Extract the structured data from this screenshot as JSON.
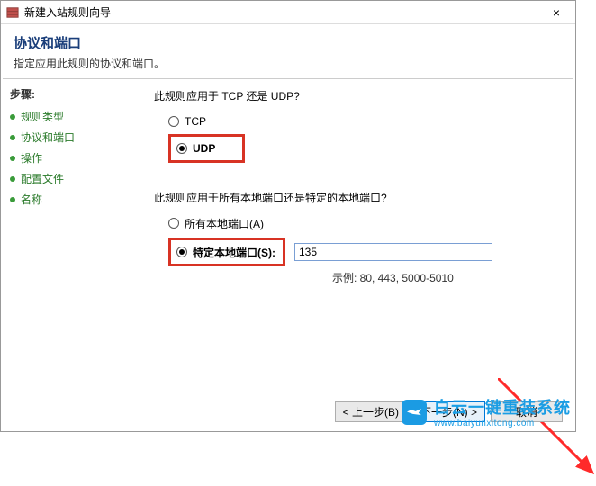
{
  "titlebar": {
    "title": "新建入站规则向导",
    "close": "×"
  },
  "header": {
    "title": "协议和端口",
    "subtitle": "指定应用此规则的协议和端口。"
  },
  "sidebar": {
    "heading": "步骤:",
    "items": [
      {
        "label": "规则类型"
      },
      {
        "label": "协议和端口"
      },
      {
        "label": "操作"
      },
      {
        "label": "配置文件"
      },
      {
        "label": "名称"
      }
    ]
  },
  "content": {
    "question1": "此规则应用于 TCP 还是 UDP?",
    "opt_tcp": "TCP",
    "opt_udp": "UDP",
    "question2": "此规则应用于所有本地端口还是特定的本地端口?",
    "opt_all_ports": "所有本地端口(A)",
    "opt_specific_ports": "特定本地端口(S):",
    "port_value": "135",
    "example": "示例: 80, 443, 5000-5010"
  },
  "footer": {
    "back": "< 上一步(B)",
    "next": "下一步(N) >",
    "cancel": "取消"
  },
  "watermark": {
    "line1": "白云一键重装系统",
    "line2": "www.baiyunxitong.com"
  }
}
